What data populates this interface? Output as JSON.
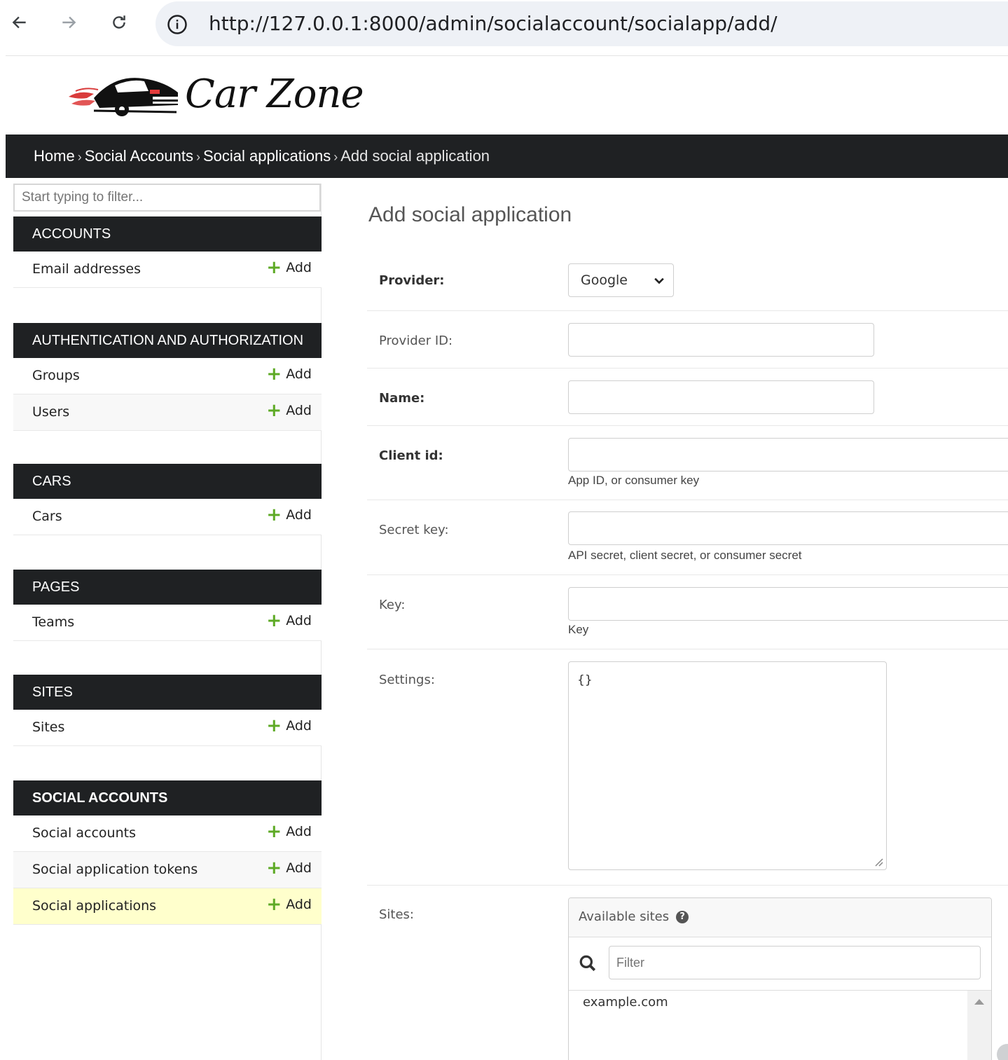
{
  "browser": {
    "url": "http://127.0.0.1:8000/admin/socialaccount/socialapp/add/"
  },
  "logo": {
    "text": "Car Zone"
  },
  "breadcrumbs": {
    "home": "Home",
    "app": "Social Accounts",
    "model": "Social applications",
    "current": "Add social application",
    "separator": "›"
  },
  "sidebar": {
    "filter_placeholder": "Start typing to filter...",
    "add_label": "Add",
    "modules": [
      {
        "title": "ACCOUNTS",
        "items": [
          "Email addresses"
        ]
      },
      {
        "title": "AUTHENTICATION AND AUTHORIZATION",
        "items": [
          "Groups",
          "Users"
        ]
      },
      {
        "title": "CARS",
        "items": [
          "Cars"
        ]
      },
      {
        "title": "PAGES",
        "items": [
          "Teams"
        ]
      },
      {
        "title": "SITES",
        "items": [
          "Sites"
        ]
      },
      {
        "title": "SOCIAL ACCOUNTS",
        "items": [
          "Social accounts",
          "Social application tokens",
          "Social applications"
        ]
      }
    ]
  },
  "form": {
    "title": "Add social application",
    "provider": {
      "label": "Provider:",
      "value": "Google"
    },
    "provider_id": {
      "label": "Provider ID:",
      "value": ""
    },
    "name": {
      "label": "Name:",
      "value": ""
    },
    "client_id": {
      "label": "Client id:",
      "value": "",
      "help": "App ID, or consumer key"
    },
    "secret": {
      "label": "Secret key:",
      "value": "",
      "help": "API secret, client secret, or consumer secret"
    },
    "key": {
      "label": "Key:",
      "value": "",
      "help": "Key"
    },
    "settings": {
      "label": "Settings:",
      "value": "{}"
    },
    "sites": {
      "label": "Sites:",
      "available_title": "Available sites",
      "filter_placeholder": "Filter",
      "options": [
        "example.com"
      ]
    }
  }
}
